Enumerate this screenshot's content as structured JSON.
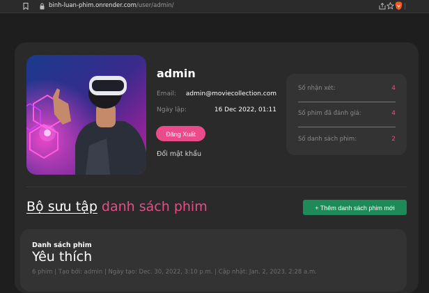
{
  "browser": {
    "url_host": "binh-luan-phim.onrender.com",
    "url_path": "/user/admin/"
  },
  "profile": {
    "username": "admin",
    "email_label": "Email:",
    "email_value": "admin@moviecollection.com",
    "joined_label": "Ngày lập:",
    "joined_value": "16 Dec 2022, 01:11",
    "logout_label": "Đăng Xuất",
    "change_password_label": "Đổi mật khẩu"
  },
  "stats": [
    {
      "label": "Số nhận xét:",
      "value": "4"
    },
    {
      "label": "Số phim đã đánh giá:",
      "value": "4"
    },
    {
      "label": "Số danh sách phim:",
      "value": "2"
    }
  ],
  "collection": {
    "heading_white": "Bộ sưu tập",
    "heading_pink": "danh sách phim",
    "add_button_label": "+ Thêm danh sách phim mới"
  },
  "lists": [
    {
      "category": "Danh sách phim",
      "title": "Yêu thích",
      "meta": "6 phim | Tạo bởi: admin | Ngày tạo: Dec. 30, 2022, 3:10 p.m. | Cập nhật: Jan. 2, 2023, 2:28 a.m."
    }
  ],
  "colors": {
    "accent_pink": "#ea4c89",
    "accent_green": "#1e8a57",
    "page_bg": "#1e1e1e",
    "card_bg": "#2a2a2a"
  }
}
